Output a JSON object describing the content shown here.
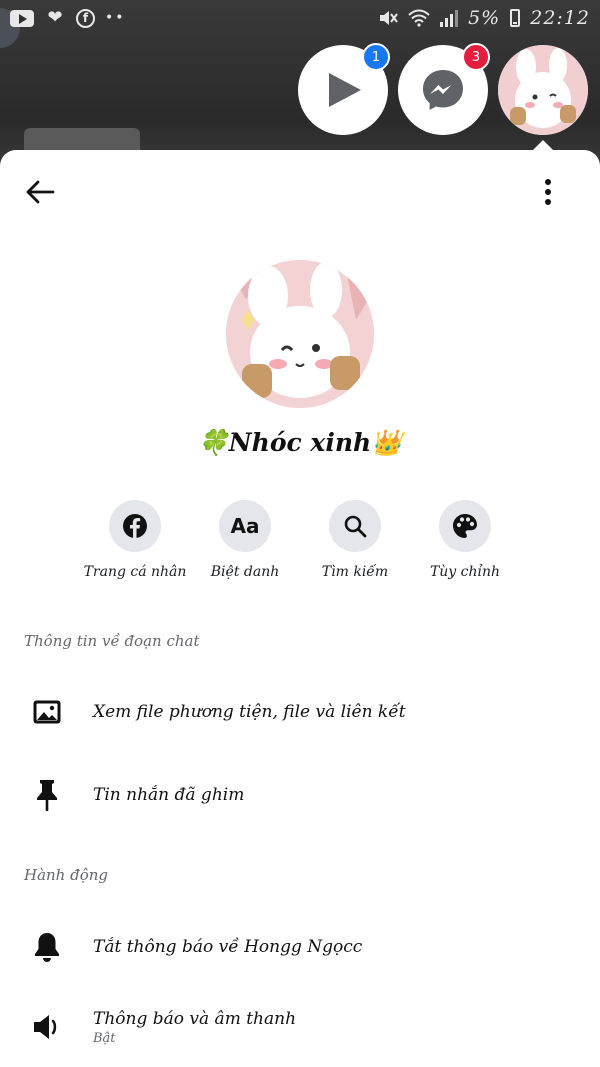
{
  "status_bar": {
    "battery": "5%",
    "time": "22:12",
    "dots": "••"
  },
  "chat_heads": [
    {
      "name": "video-head",
      "badge": "1",
      "badge_color": "#1877f2"
    },
    {
      "name": "messenger-head",
      "badge": "3",
      "badge_color": "#e41e3f"
    }
  ],
  "profile": {
    "name": "🍀Nhóc xinh👑"
  },
  "actions": [
    {
      "label": "Trang cá nhân",
      "icon": "facebook-icon"
    },
    {
      "label": "Biệt danh",
      "icon": "aa-text-icon",
      "glyph": "Aa"
    },
    {
      "label": "Tìm kiếm",
      "icon": "search-icon"
    },
    {
      "label": "Tùy chỉnh",
      "icon": "palette-icon"
    }
  ],
  "sections": {
    "chat_info": {
      "title": "Thông tin về đoạn chat",
      "rows": [
        {
          "title": "Xem file phương tiện, file và liên kết",
          "icon": "photo-icon"
        },
        {
          "title": "Tin nhắn đã ghim",
          "icon": "pin-icon"
        }
      ]
    },
    "actions": {
      "title": "Hành động",
      "rows": [
        {
          "title": "Tắt thông báo về Hongg Ngọcc",
          "icon": "bell-icon"
        },
        {
          "title": "Thông báo và âm thanh",
          "subtitle": "Bật",
          "icon": "speaker-icon"
        }
      ]
    }
  },
  "colors": {
    "panel": "#ffffff",
    "action_circle": "#e4e6eb",
    "secondary_text": "#65676b"
  }
}
